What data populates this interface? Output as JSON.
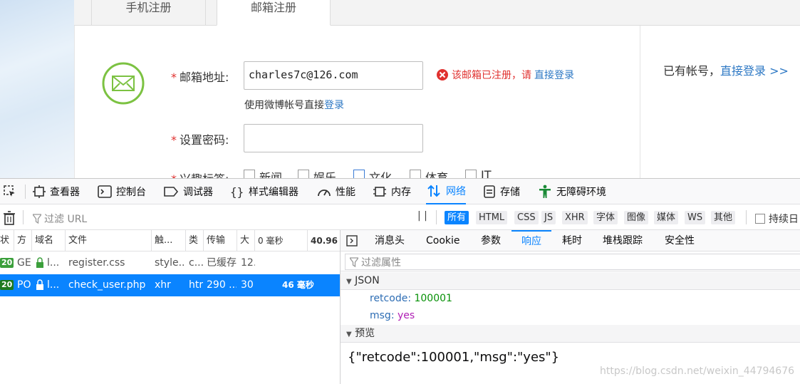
{
  "page": {
    "tabs": [
      {
        "label": "手机注册"
      },
      {
        "label": "邮箱注册"
      }
    ],
    "email_label": "邮箱地址:",
    "email_value": "charles7c@126.com",
    "error_prefix": "该邮箱已注册，请",
    "error_link": "直接登录",
    "weibo_prefix": "使用微博帐号直接",
    "weibo_link": "登录",
    "password_label": "设置密码:",
    "interest_label": "兴趣标签:",
    "interests": [
      "新闻",
      "娱乐",
      "文化",
      "体育",
      "IT"
    ],
    "have_account": "已有帐号，",
    "login_link": "直接登录 >>",
    "colors": {
      "accent": "#7cc242",
      "error": "#e0312f",
      "link": "#2d78c4"
    }
  },
  "devtools": {
    "tools": [
      {
        "label": "查看器",
        "icon": "inspector-icon"
      },
      {
        "label": "控制台",
        "icon": "console-icon"
      },
      {
        "label": "调试器",
        "icon": "debugger-icon"
      },
      {
        "label": "样式编辑器",
        "icon": "style-editor-icon"
      },
      {
        "label": "性能",
        "icon": "performance-icon"
      },
      {
        "label": "内存",
        "icon": "memory-icon"
      },
      {
        "label": "网络",
        "icon": "network-icon"
      },
      {
        "label": "存储",
        "icon": "storage-icon"
      },
      {
        "label": "无障碍环境",
        "icon": "accessibility-icon"
      }
    ],
    "filter_placeholder": "过滤 URL",
    "pause_label": "| |",
    "type_filters": [
      "所有",
      "HTML",
      "CSS",
      "JS",
      "XHR",
      "字体",
      "图像",
      "媒体",
      "WS",
      "其他"
    ],
    "persist_label": "持续日",
    "columns": [
      "状",
      "方",
      "域名",
      "文件",
      "触...",
      "类",
      "传输",
      "大",
      "0 毫秒",
      "40.96"
    ],
    "requests": [
      {
        "status": "20",
        "method": "GE",
        "domain": "l...",
        "file": "register.css",
        "cause": "style...",
        "type": "c...",
        "transfer": "已缓存",
        "size": "12.",
        "time": ""
      },
      {
        "status": "20",
        "method": "PO",
        "domain": "l...",
        "file": "check_user.php",
        "cause": "xhr",
        "type": "htr",
        "transfer": "290 ...",
        "size": "30",
        "time": "46 毫秒"
      }
    ],
    "detail_tabs": [
      "消息头",
      "Cookie",
      "参数",
      "响应",
      "耗时",
      "堆栈跟踪",
      "安全性"
    ],
    "filter_props_placeholder": "过滤属性",
    "json_section": "JSON",
    "json": {
      "retcode_key": "retcode:",
      "retcode_val": "100001",
      "msg_key": "msg:",
      "msg_val": "yes"
    },
    "preview_section": "预览",
    "raw_response": "{\"retcode\":100001,\"msg\":\"yes\"}",
    "watermark": "https://blog.csdn.net/weixin_44794676"
  }
}
